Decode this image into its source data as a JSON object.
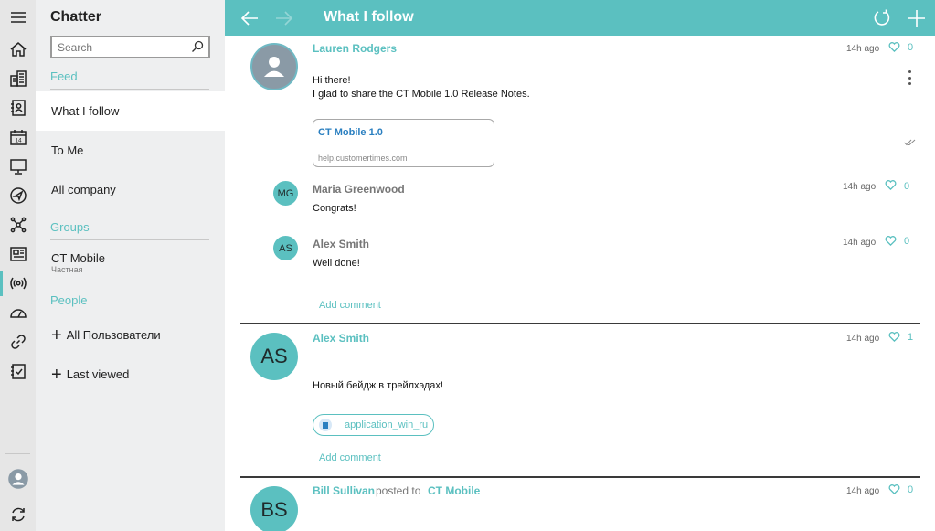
{
  "app": {
    "title": "Chatter"
  },
  "search": {
    "placeholder": "Search"
  },
  "sidebar": {
    "feed_heading": "Feed",
    "feed_items": [
      {
        "label": "What I follow",
        "active": true
      },
      {
        "label": "To Me"
      },
      {
        "label": "All company"
      }
    ],
    "groups_heading": "Groups",
    "group": {
      "name": "CT Mobile",
      "sub": "Частная"
    },
    "people_heading": "People",
    "people_items": [
      {
        "label": "All Пользователи"
      },
      {
        "label": "Last viewed"
      }
    ]
  },
  "rail_icons": [
    "hamburger-icon",
    "home-icon",
    "buildings-icon",
    "contacts-icon",
    "calendar-icon",
    "presentation-icon",
    "navigation-icon",
    "network-icon",
    "news-icon",
    "broadcast-icon",
    "dashboard-icon",
    "link-icon",
    "checklist-icon",
    "user-icon",
    "sync-icon"
  ],
  "calendar_day": "14",
  "header": {
    "title": "What I follow"
  },
  "colors": {
    "accent": "#5bc0c0",
    "link": "#2a7fc0"
  },
  "posts": [
    {
      "author": "Lauren Rodgers",
      "time": "14h ago",
      "likes": "0",
      "text_line1": "Hi there!",
      "text_line2": "I glad to share the CT Mobile 1.0 Release Notes.",
      "link_title": "CT Mobile 1.0",
      "link_url": "help.customertimes.com",
      "comments": [
        {
          "initials": "MG",
          "author": "Maria Greenwood",
          "time": "14h ago",
          "likes": "0",
          "text": "Congrats!"
        },
        {
          "initials": "AS",
          "author": "Alex Smith",
          "time": "14h ago",
          "likes": "0",
          "text": "Well done!"
        }
      ],
      "add_comment": "Add comment"
    },
    {
      "initials": "AS",
      "author": "Alex Smith",
      "time": "14h ago",
      "likes": "1",
      "text": "Новый бейдж в трейлхэдах!",
      "file_name": "application_win_ru",
      "add_comment": "Add comment"
    },
    {
      "initials": "BS",
      "author": "Bill Sullivan",
      "posted_to_label": "posted to",
      "posted_to": "CT Mobile",
      "time": "14h ago",
      "likes": "0"
    }
  ]
}
